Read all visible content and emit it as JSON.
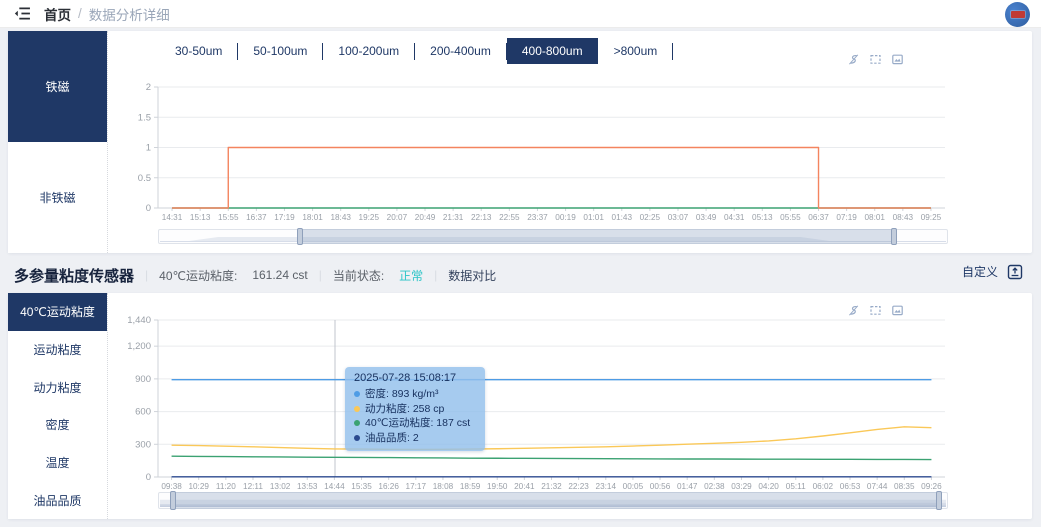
{
  "topbar": {
    "home": "首页",
    "separator": "/",
    "current": "数据分析详细"
  },
  "section2": {
    "title": "多参量粘度传感器",
    "divider": "|",
    "metric_label": "40℃运动粘度:",
    "metric_value": "161.24 cst",
    "status_label": "当前状态:",
    "status_value": "正常",
    "compare_label": "数据对比",
    "custom_label": "自定义"
  },
  "colors": {
    "navy": "#1f3866",
    "teal": "#2dc5c7",
    "orange": "#f4845f",
    "green": "#3ba272",
    "blue": "#4e9ce5",
    "yellow": "#fac858",
    "dark_blue": "#2b4a8f"
  },
  "panel1": {
    "sidebar": [
      {
        "label": "铁磁",
        "active": true
      },
      {
        "label": "非铁磁",
        "active": false
      }
    ],
    "tabs": [
      {
        "label": "30-50um",
        "active": false
      },
      {
        "label": "50-100um",
        "active": false
      },
      {
        "label": "100-200um",
        "active": false
      },
      {
        "label": "200-400um",
        "active": false
      },
      {
        "label": "400-800um",
        "active": true
      },
      {
        "label": ">800um",
        "active": false
      }
    ]
  },
  "panel2": {
    "sidebar": [
      {
        "label": "40℃运动粘度",
        "active": true
      },
      {
        "label": "运动粘度",
        "active": false
      },
      {
        "label": "动力粘度",
        "active": false
      },
      {
        "label": "密度",
        "active": false
      },
      {
        "label": "温度",
        "active": false
      },
      {
        "label": "油品品质",
        "active": false
      }
    ]
  },
  "toolbox_icons": [
    "restore-icon",
    "box-select-icon",
    "save-image-icon"
  ],
  "tooltip": {
    "title": "2025-07-28 15:08:17",
    "rows": [
      {
        "dot": "#4e9ce5",
        "label": "密度:",
        "value": "893 kg/m³"
      },
      {
        "dot": "#fac858",
        "label": "动力粘度:",
        "value": "258 cp"
      },
      {
        "dot": "#3ba272",
        "label": "40℃运动粘度:",
        "value": "187 cst"
      },
      {
        "dot": "#2b4a8f",
        "label": "油品品质:",
        "value": "2"
      }
    ]
  },
  "chart_data": [
    {
      "type": "line",
      "x": [
        "14:31",
        "15:13",
        "15:55",
        "16:37",
        "17:19",
        "18:01",
        "18:43",
        "19:25",
        "20:07",
        "20:49",
        "21:31",
        "22:13",
        "22:55",
        "23:37",
        "00:19",
        "01:01",
        "01:43",
        "02:25",
        "03:07",
        "03:49",
        "04:31",
        "05:13",
        "05:55",
        "06:37",
        "07:19",
        "08:01",
        "08:43",
        "09:25"
      ],
      "ylim": [
        0,
        2
      ],
      "yticks": [
        0,
        0.5,
        1,
        1.5,
        2
      ],
      "ytick_labels": [
        "0",
        "0.5",
        "1",
        "1.5",
        "2"
      ],
      "grid": true,
      "legend_position": "none",
      "series": [
        {
          "color": "#3ba272",
          "step": false,
          "values": [
            0,
            0,
            0,
            0,
            0,
            0,
            0,
            0,
            0,
            0,
            0,
            0,
            0,
            0,
            0,
            0,
            0,
            0,
            0,
            0,
            0,
            0,
            0,
            0,
            0,
            0,
            0,
            0
          ]
        },
        {
          "color": "#f4845f",
          "step": true,
          "values": [
            0,
            0,
            1,
            1,
            1,
            1,
            1,
            1,
            1,
            1,
            1,
            1,
            1,
            1,
            1,
            1,
            1,
            1,
            1,
            1,
            1,
            1,
            1,
            0,
            0,
            0,
            0,
            0
          ]
        }
      ],
      "zoom_window": {
        "start": 0.178,
        "end": 0.934
      }
    },
    {
      "type": "line",
      "x": [
        "09:38",
        "10:29",
        "11:20",
        "12:11",
        "13:02",
        "13:53",
        "14:44",
        "15:35",
        "16:26",
        "17:17",
        "18:08",
        "18:59",
        "19:50",
        "20:41",
        "21:32",
        "22:23",
        "23:14",
        "00:05",
        "00:56",
        "01:47",
        "02:38",
        "03:29",
        "04:20",
        "05:11",
        "06:02",
        "06:53",
        "07:44",
        "08:35",
        "09:26"
      ],
      "ylim": [
        0,
        1440
      ],
      "yticks": [
        0,
        300,
        600,
        900,
        1200,
        1440
      ],
      "ytick_labels": [
        "0",
        "300",
        "600",
        "900",
        "1,200",
        "1,440"
      ],
      "grid": true,
      "legend_position": "none",
      "series": [
        {
          "name": "密度",
          "color": "#4e9ce5",
          "step": false,
          "values": [
            893,
            893,
            893,
            893,
            893,
            893,
            893,
            893,
            893,
            893,
            893,
            893,
            893,
            893,
            893,
            893,
            893,
            893,
            893,
            893,
            893,
            893,
            893,
            893,
            893,
            893,
            893,
            893,
            893
          ]
        },
        {
          "name": "动力粘度",
          "color": "#fac858",
          "step": false,
          "values": [
            292,
            288,
            283,
            277,
            270,
            263,
            257,
            256,
            254,
            253,
            254,
            256,
            259,
            263,
            268,
            272,
            277,
            284,
            292,
            301,
            309,
            318,
            331,
            350,
            376,
            405,
            436,
            460,
            452
          ]
        },
        {
          "name": "40℃运动粘度",
          "color": "#3ba272",
          "step": false,
          "values": [
            191,
            189,
            187,
            185,
            184,
            182,
            181,
            179,
            178,
            176,
            175,
            173,
            172,
            171,
            170,
            169,
            168,
            167,
            166,
            165,
            165,
            164,
            163,
            163,
            162,
            162,
            161,
            161,
            160
          ]
        },
        {
          "name": "油品品质",
          "color": "#2b4a8f",
          "step": false,
          "values": [
            2,
            2,
            2,
            2,
            2,
            2,
            2,
            2,
            2,
            2,
            2,
            2,
            2,
            2,
            2,
            2,
            2,
            2,
            2,
            2,
            2,
            2,
            2,
            2,
            2,
            2,
            2,
            2,
            2
          ]
        }
      ],
      "axis_pointer_x": 207,
      "zoom_window": {
        "start": 0.016,
        "end": 0.991
      }
    }
  ]
}
